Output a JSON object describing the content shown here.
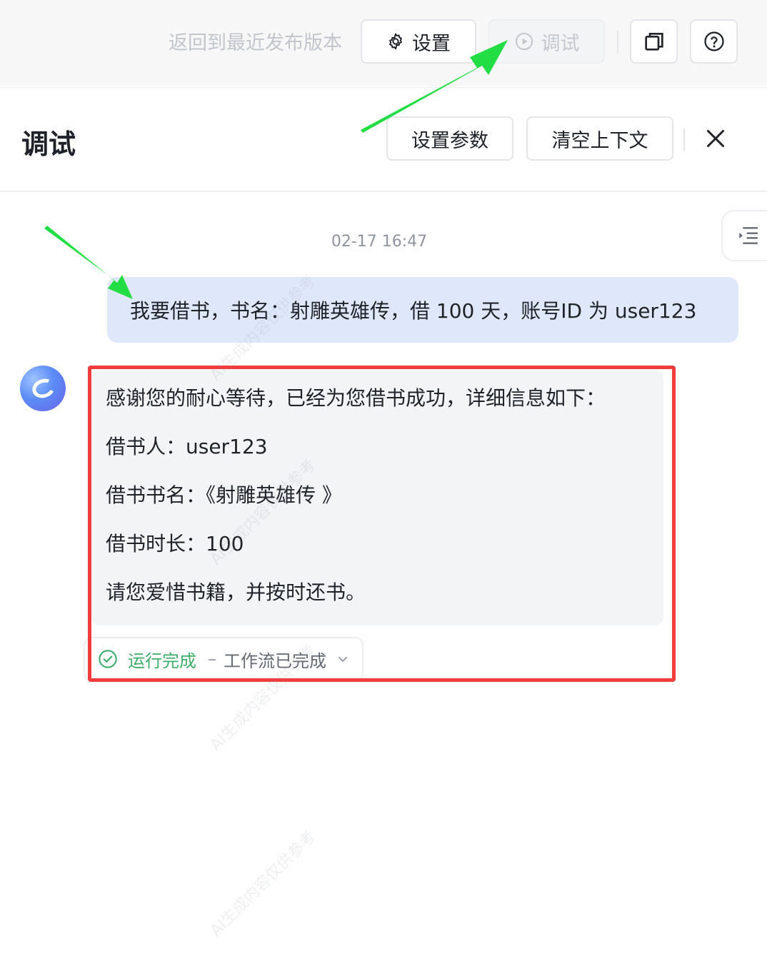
{
  "toolbar": {
    "revert_label": "返回到最近发布版本",
    "settings_label": "设置",
    "debug_label": "调试"
  },
  "panel": {
    "title": "调试",
    "set_params_label": "设置参数",
    "clear_context_label": "清空上下文"
  },
  "chat": {
    "timestamp": "02-17 16:47",
    "user_message": "我要借书，书名：射雕英雄传，借 100 天，账号ID 为 user123",
    "bot_lines": [
      "感谢您的耐心等待，已经为您借书成功，详细信息如下：",
      "借书人：user123",
      "借书书名：《射雕英雄传 》",
      "借书时长：100",
      "请您爱惜书籍，并按时还书。"
    ],
    "run_status": "运行完成",
    "run_separator": "–",
    "run_detail": "工作流已完成"
  },
  "watermark_text": "AI生成内容仅供参考",
  "colors": {
    "annotation_arrow": "#22dd44",
    "highlight_frame": "#f23c3c",
    "user_bubble": "#dfe8fb",
    "success": "#3fae6c"
  },
  "icons": [
    "gear-icon",
    "play-circle-icon",
    "copy-icon",
    "help-icon",
    "close-icon",
    "collapse-panel-icon",
    "check-circle-icon",
    "chevron-down-icon"
  ]
}
